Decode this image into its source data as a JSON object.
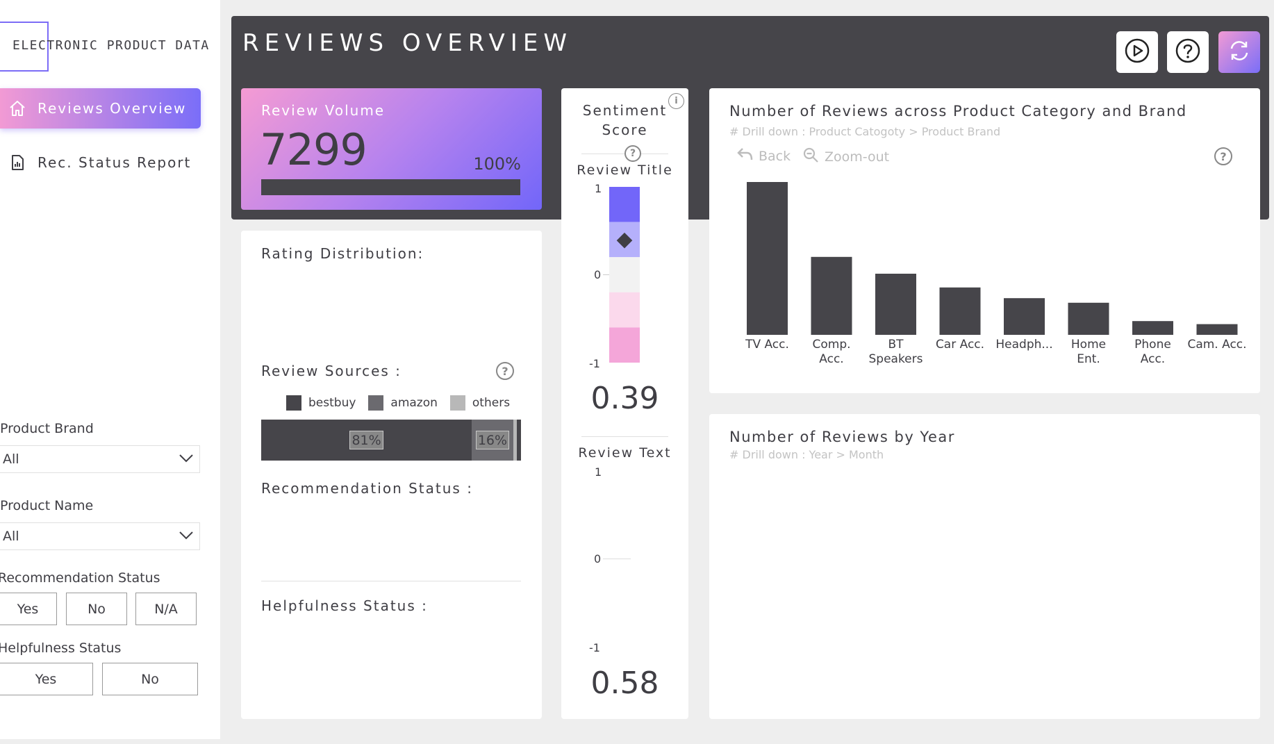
{
  "sidebar": {
    "logo_text": "ELECTRONIC PRODUCT DATA",
    "nav": [
      {
        "label": "Reviews Overview",
        "active": true,
        "icon": "home-icon"
      },
      {
        "label": "Rec. Status Report",
        "active": false,
        "icon": "report-icon"
      }
    ],
    "filters": {
      "brand": {
        "label": "Product Brand",
        "value": "All"
      },
      "name": {
        "label": "Product Name",
        "value": "All"
      },
      "recommendation": {
        "label": "Recommendation Status",
        "options": [
          "Yes",
          "No",
          "N/A"
        ]
      },
      "helpfulness": {
        "label": "Helpfulness Status",
        "options": [
          "Yes",
          "No"
        ]
      }
    }
  },
  "header": {
    "title": "REVIEWS OVERVIEW",
    "buttons": [
      "play-icon",
      "help-icon",
      "refresh-icon"
    ]
  },
  "kpi": {
    "label": "Review Volume",
    "value": "7299",
    "percent": "100%",
    "fill": 1.0
  },
  "rating": {
    "title": "Rating Distribution:"
  },
  "sources": {
    "title": "Review Sources :",
    "legend": [
      {
        "name": "bestbuy",
        "color": "#46454a"
      },
      {
        "name": "amazon",
        "color": "#6b6a6f"
      },
      {
        "name": "others",
        "color": "#b8b8b8"
      }
    ],
    "shares": [
      {
        "name": "bestbuy",
        "value": 81,
        "label": "81%",
        "color": "#46454a"
      },
      {
        "name": "amazon",
        "value": 16,
        "label": "16%",
        "color": "#6b6a6f"
      },
      {
        "name": "others",
        "value": 3,
        "label": "",
        "color": "#b8b8b8"
      }
    ]
  },
  "recommendation": {
    "title": "Recommendation Status :"
  },
  "helpfulness": {
    "title": "Helpfulness Status :"
  },
  "sentiment": {
    "title_line1": "Sentiment",
    "title_line2": "Score",
    "review_title": {
      "label": "Review Title",
      "max": "1",
      "mid": "0",
      "min": "-1",
      "score": "0.39",
      "value": 0.39
    },
    "review_text": {
      "label": "Review Text",
      "max": "1",
      "mid": "0",
      "min": "-1",
      "score": "0.58"
    },
    "scale_colors": [
      "#7266f9",
      "#b5b0fb",
      "#f2f2f2",
      "#fbd9ec",
      "#f4a6d9"
    ]
  },
  "category_chart": {
    "title": "Number of Reviews across Product Category and Brand",
    "subtitle": "# Drill down : Product Catogoty > Product Brand",
    "back": "Back",
    "zoom": "Zoom-out"
  },
  "year_chart": {
    "title": "Number of Reviews by Year",
    "subtitle": "# Drill down : Year > Month"
  },
  "chart_data": {
    "type": "bar",
    "categories": [
      "TV Acc.",
      "Comp. Acc.",
      "BT Speakers",
      "Car Acc.",
      "Headph...",
      "Home Ent.",
      "Phone Acc.",
      "Cam. Acc."
    ],
    "category_lines": [
      [
        "TV Acc."
      ],
      [
        "Comp.",
        "Acc."
      ],
      [
        "BT",
        "Speakers"
      ],
      [
        "Car Acc."
      ],
      [
        "Headph..."
      ],
      [
        "Home",
        "Ent."
      ],
      [
        "Phone",
        "Acc."
      ],
      [
        "Cam. Acc."
      ]
    ],
    "values": [
      100,
      51,
      40,
      31,
      24,
      21,
      9,
      7
    ],
    "ylim": [
      0,
      100
    ],
    "bar_color": "#46454a",
    "grid": false,
    "legend": "none"
  }
}
